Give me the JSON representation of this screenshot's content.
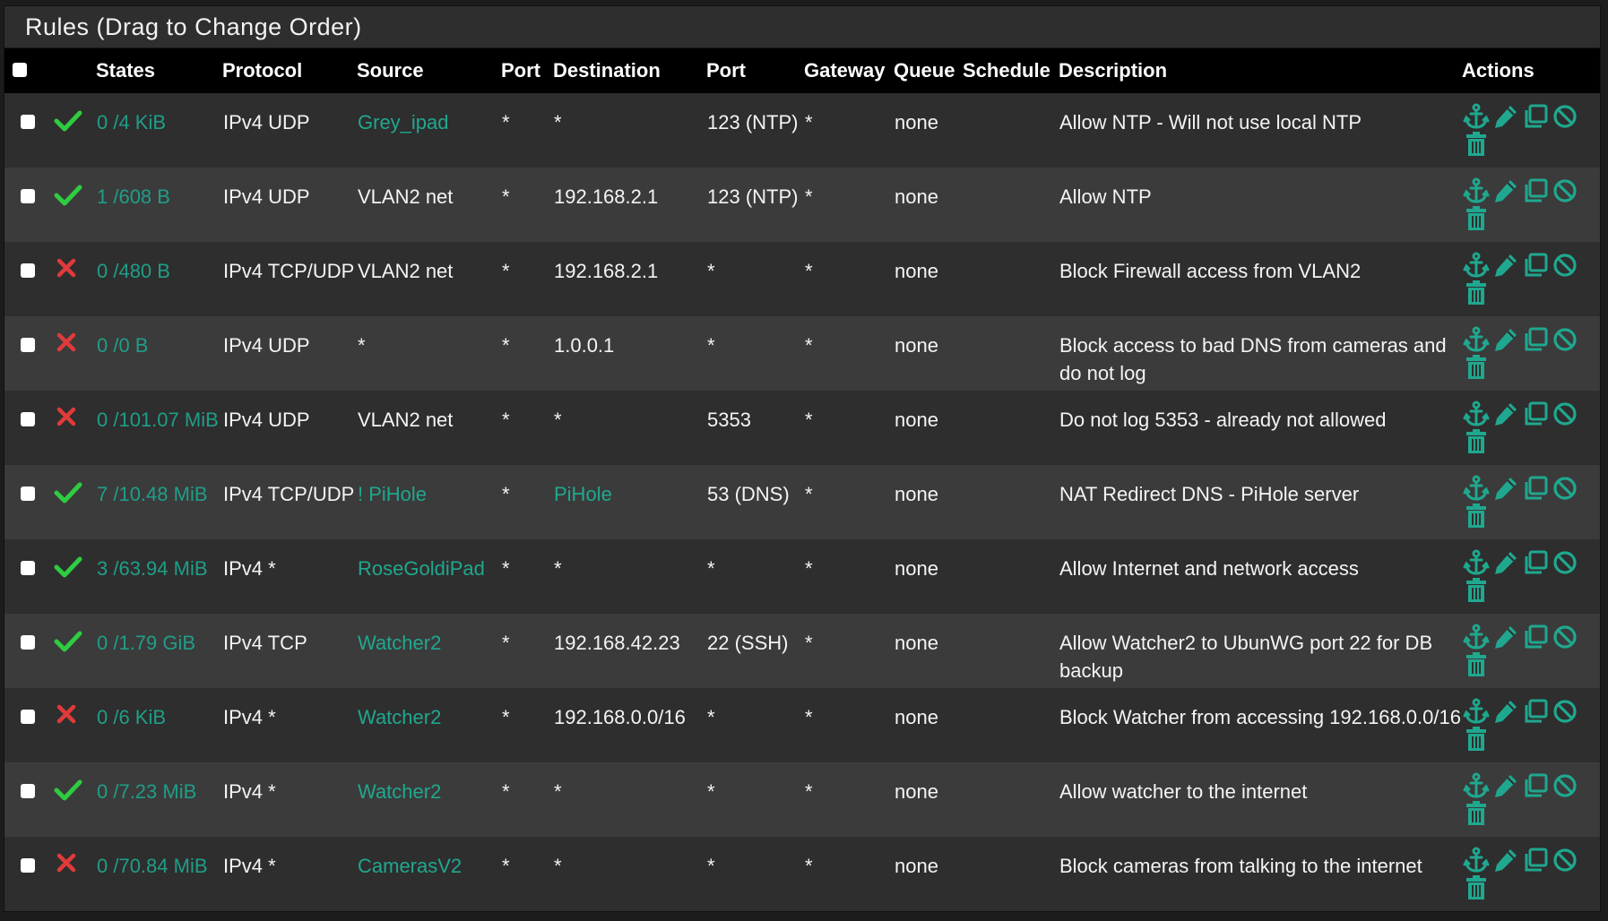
{
  "panel": {
    "title": "Rules (Drag to Change Order)"
  },
  "colors": {
    "accent": "#1fa88f",
    "pass": "#2ecc40",
    "block": "#e03a3a"
  },
  "columns": {
    "states": "States",
    "protocol": "Protocol",
    "source": "Source",
    "port": "Port",
    "destination": "Destination",
    "dport": "Port",
    "gateway": "Gateway",
    "queue": "Queue",
    "schedule": "Schedule",
    "description": "Description",
    "actions": "Actions"
  },
  "rules": [
    {
      "action": "pass",
      "states": "0 /4 KiB",
      "protocol": "IPv4 UDP",
      "source": "Grey_ipad",
      "source_link": true,
      "sport": "*",
      "destination": "*",
      "dest_link": false,
      "dport": "123 (NTP)",
      "gateway": "*",
      "queue": "none",
      "schedule": "",
      "description": "Allow NTP - Will not use local NTP"
    },
    {
      "action": "pass",
      "states": "1 /608 B",
      "protocol": "IPv4 UDP",
      "source": "VLAN2 net",
      "source_link": false,
      "sport": "*",
      "destination": "192.168.2.1",
      "dest_link": false,
      "dport": "123 (NTP)",
      "gateway": "*",
      "queue": "none",
      "schedule": "",
      "description": "Allow NTP"
    },
    {
      "action": "block",
      "states": "0 /480 B",
      "protocol": "IPv4 TCP/UDP",
      "source": "VLAN2 net",
      "source_link": false,
      "sport": "*",
      "destination": "192.168.2.1",
      "dest_link": false,
      "dport": "*",
      "gateway": "*",
      "queue": "none",
      "schedule": "",
      "description": "Block Firewall access from VLAN2"
    },
    {
      "action": "block",
      "states": "0 /0 B",
      "protocol": "IPv4 UDP",
      "source": "*",
      "source_link": false,
      "sport": "*",
      "destination": "1.0.0.1",
      "dest_link": false,
      "dport": "*",
      "gateway": "*",
      "queue": "none",
      "schedule": "",
      "description": "Block access to bad DNS from cameras and do not log"
    },
    {
      "action": "block",
      "states": "0 /101.07 MiB",
      "protocol": "IPv4 UDP",
      "source": "VLAN2 net",
      "source_link": false,
      "sport": "*",
      "destination": "*",
      "dest_link": false,
      "dport": "5353",
      "gateway": "*",
      "queue": "none",
      "schedule": "",
      "description": "Do not log 5353 - already not allowed"
    },
    {
      "action": "pass",
      "states": "7 /10.48 MiB",
      "protocol": "IPv4 TCP/UDP",
      "source": "! PiHole",
      "source_link": true,
      "sport": "*",
      "destination": "PiHole",
      "dest_link": true,
      "dport": "53 (DNS)",
      "gateway": "*",
      "queue": "none",
      "schedule": "",
      "description": "NAT Redirect DNS - PiHole server"
    },
    {
      "action": "pass",
      "states": "3 /63.94 MiB",
      "protocol": "IPv4 *",
      "source": "RoseGoldiPad",
      "source_link": true,
      "sport": "*",
      "destination": "*",
      "dest_link": false,
      "dport": "*",
      "gateway": "*",
      "queue": "none",
      "schedule": "",
      "description": "Allow Internet and network access"
    },
    {
      "action": "pass",
      "states": "0 /1.79 GiB",
      "protocol": "IPv4 TCP",
      "source": "Watcher2",
      "source_link": true,
      "sport": "*",
      "destination": "192.168.42.23",
      "dest_link": false,
      "dport": "22 (SSH)",
      "gateway": "*",
      "queue": "none",
      "schedule": "",
      "description": "Allow Watcher2 to UbunWG port 22 for DB backup"
    },
    {
      "action": "block",
      "states": "0 /6 KiB",
      "protocol": "IPv4 *",
      "source": "Watcher2",
      "source_link": true,
      "sport": "*",
      "destination": "192.168.0.0/16",
      "dest_link": false,
      "dport": "*",
      "gateway": "*",
      "queue": "none",
      "schedule": "",
      "description": "Block Watcher from accessing 192.168.0.0/16"
    },
    {
      "action": "pass",
      "states": "0 /7.23 MiB",
      "protocol": "IPv4 *",
      "source": "Watcher2",
      "source_link": true,
      "sport": "*",
      "destination": "*",
      "dest_link": false,
      "dport": "*",
      "gateway": "*",
      "queue": "none",
      "schedule": "",
      "description": "Allow watcher to the internet"
    },
    {
      "action": "block",
      "states": "0 /70.84 MiB",
      "protocol": "IPv4 *",
      "source": "CamerasV2",
      "source_link": true,
      "sport": "*",
      "destination": "*",
      "dest_link": false,
      "dport": "*",
      "gateway": "*",
      "queue": "none",
      "schedule": "",
      "description": "Block cameras from talking to the internet"
    }
  ]
}
